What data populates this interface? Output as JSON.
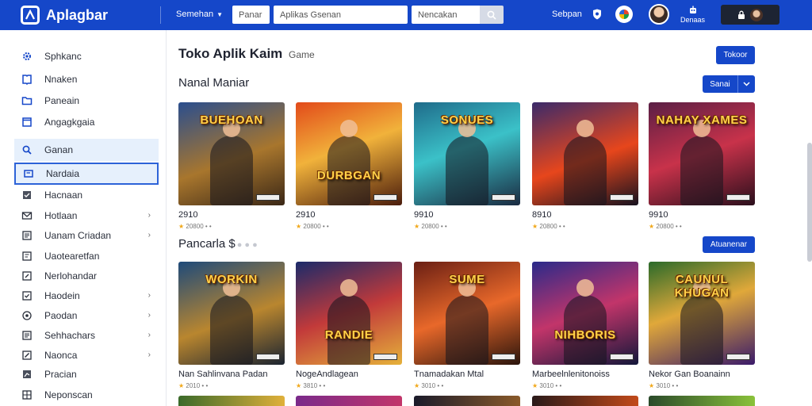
{
  "brand": {
    "name": "Aplagbar"
  },
  "topbar": {
    "category_label": "Semehan",
    "field1_placeholder": "Panar",
    "field2_placeholder": "Aplikas Gsenan",
    "field3_placeholder": "Nencakan",
    "link_label": "Sebpan",
    "profile_label": "Denaas",
    "account_label": " "
  },
  "sidebar": {
    "items": [
      {
        "label": "Sphkanc",
        "icon": "gear-icon"
      },
      {
        "label": "Nnaken",
        "icon": "book-icon"
      },
      {
        "label": "Paneain",
        "icon": "folder-icon"
      },
      {
        "label": "Angagkgaia",
        "icon": "window-icon"
      },
      {
        "label": "Ganan",
        "icon": "search-icon"
      },
      {
        "label": "Nardaia",
        "icon": "square-icon"
      },
      {
        "label": "Hacnaan",
        "icon": "check-box-icon"
      },
      {
        "label": "Hotlaan",
        "icon": "mail-icon"
      },
      {
        "label": "Uanam Criadan",
        "icon": "list-icon"
      },
      {
        "label": "Uaotearetfan",
        "icon": "doc-icon"
      },
      {
        "label": "Nerlohandar",
        "icon": "edit-icon"
      },
      {
        "label": "Haodein",
        "icon": "check-icon"
      },
      {
        "label": "Paodan",
        "icon": "circle-icon"
      },
      {
        "label": "Sehhachars",
        "icon": "list-icon"
      },
      {
        "label": "Naonca",
        "icon": "pencil-icon"
      },
      {
        "label": "Pracian",
        "icon": "chart-icon"
      },
      {
        "label": "Neponscan",
        "icon": "grid-icon"
      }
    ]
  },
  "main": {
    "title": "Toko Aplik Kaim",
    "subtitle": "Game",
    "top_button": "Tokoor",
    "section1": {
      "title": "Nanal Maniar",
      "button": "Sanai"
    },
    "section2": {
      "title": "Pancarla",
      "title_suffix": "$",
      "button": "Atuanenar"
    },
    "row1": [
      {
        "art": "BUEHOAN",
        "title": "2910",
        "meta": "20800 • •",
        "bg": "linear-gradient(160deg,#2a4e8e 0%,#a8762d 55%,#3a2716 100%)"
      },
      {
        "art": "DURBGAN",
        "title": "2910",
        "meta": "20800 • •",
        "bg": "linear-gradient(160deg,#e24a1a 0%,#f1b23b 45%,#4a1c0c 100%)"
      },
      {
        "art": "SONUES",
        "title": "9910",
        "meta": "20800 • •",
        "bg": "linear-gradient(160deg,#1f6b8a 0%,#3bc1c8 45%,#1a2a40 100%)"
      },
      {
        "art": "",
        "title": "8910",
        "meta": "20800 • •",
        "bg": "linear-gradient(160deg,#3a2a6a 0%,#e7461c 55%,#16121f 100%)"
      },
      {
        "art": "NAHAY XAMES",
        "title": "9910",
        "meta": "20800 • •",
        "bg": "linear-gradient(160deg,#5a1f45 0%,#c8324a 50%,#2a0f1c 100%)"
      }
    ],
    "row2": [
      {
        "art": "WORKIN",
        "title": "Nan Sahlinvana Padan",
        "meta": "2010 • •",
        "bg": "linear-gradient(160deg,#1e4a7a 0%,#b9862f 55%,#1a2330 100%)"
      },
      {
        "art": "RANDIE",
        "title": "NogeAndlagean",
        "meta": "3810 • •",
        "bg": "linear-gradient(160deg,#1b2a6a 0%,#c23a3a 50%,#e5b13a 100%)"
      },
      {
        "art": "SUME",
        "title": "Tnamadakan Mtal",
        "meta": "3010 • •",
        "bg": "linear-gradient(160deg,#6a1f14 0%,#e8682a 50%,#2a140c 100%)"
      },
      {
        "art": "NIHBORIS",
        "title": "Marbeelnlenitonoiss",
        "meta": "3010 • •",
        "bg": "linear-gradient(160deg,#2a2a8a 0%,#c2356a 50%,#13173a 100%)"
      },
      {
        "art": "CAUNUL KHUGAN",
        "title": "Nekor Gan Boanainn",
        "meta": "3010 • •",
        "bg": "linear-gradient(160deg,#2a6a2a 0%,#e0a83a 45%,#3a1a6a 100%)"
      }
    ],
    "row3_colors": [
      "linear-gradient(90deg,#3a6a2a,#e0b03a)",
      "linear-gradient(90deg,#7a2a8a,#c2356a)",
      "linear-gradient(90deg,#1a1a2a,#8a5a2a)",
      "linear-gradient(90deg,#2a1a1a,#c24a1a)",
      "linear-gradient(90deg,#2a4a2a,#8ac23a)"
    ]
  },
  "colors": {
    "accent": "#1547c9",
    "highlight": "#e6f0fc",
    "selected_border": "#2d63d8"
  }
}
